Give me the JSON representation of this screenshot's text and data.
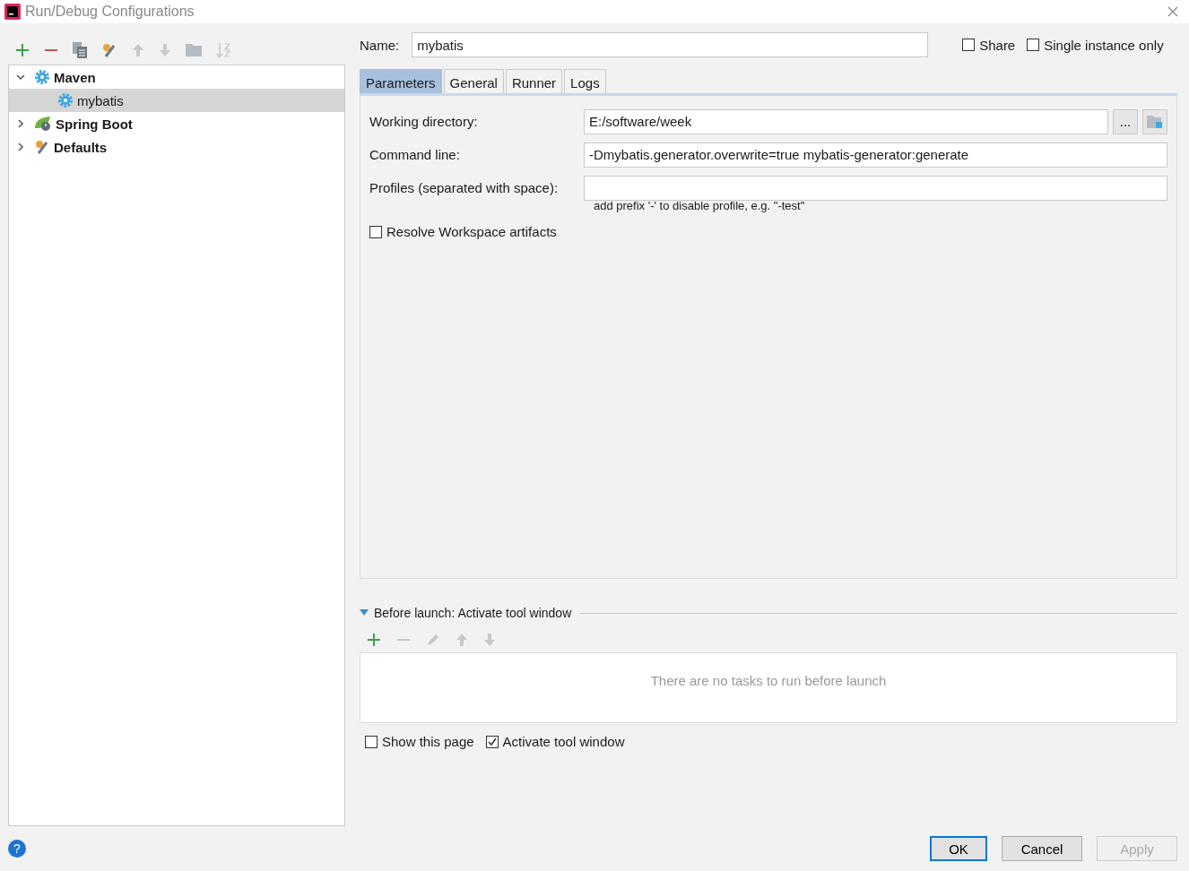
{
  "window": {
    "title": "Run/Debug Configurations"
  },
  "tree": [
    {
      "label": "Maven",
      "kind": "maven",
      "expanded": true,
      "selected": false,
      "children": [
        {
          "label": "mybatis",
          "kind": "config",
          "selected": true
        }
      ]
    },
    {
      "label": "Spring Boot",
      "kind": "spring",
      "expanded": false,
      "selected": false
    },
    {
      "label": "Defaults",
      "kind": "defaults",
      "expanded": false,
      "selected": false
    }
  ],
  "name_field": {
    "label": "Name:",
    "value": "mybatis"
  },
  "top_checkboxes": [
    {
      "label": "Share",
      "checked": false
    },
    {
      "label": "Single instance only",
      "checked": false
    }
  ],
  "tabs": [
    {
      "label": "Parameters",
      "selected": true
    },
    {
      "label": "General",
      "selected": false
    },
    {
      "label": "Runner",
      "selected": false
    },
    {
      "label": "Logs",
      "selected": false
    }
  ],
  "fields": [
    {
      "label": "Working directory:",
      "value": "E:/software/week",
      "browse_button": "..."
    },
    {
      "label": "Command line:",
      "value": "-Dmybatis.generator.overwrite=true mybatis-generator:generate"
    },
    {
      "label": "Profiles (separated with space):",
      "hint": "add prefix '-' to disable profile, e.g. \"-test\""
    }
  ],
  "resolve_checkbox": {
    "label": "Resolve Workspace artifacts",
    "checked": false
  },
  "before_launch": {
    "title": "Before launch: Activate tool window",
    "expanded": true,
    "empty_text": "There are no tasks to run before launch"
  },
  "bottom_checkboxes": [
    {
      "label": "Show this page",
      "checked": false
    },
    {
      "label": "Activate tool window",
      "checked": true
    }
  ],
  "help_button": "?",
  "buttons": [
    {
      "label": "OK",
      "default": true,
      "disabled": false
    },
    {
      "label": "Cancel",
      "default": false,
      "disabled": false
    },
    {
      "label": "Apply",
      "default": false,
      "disabled": true
    }
  ]
}
